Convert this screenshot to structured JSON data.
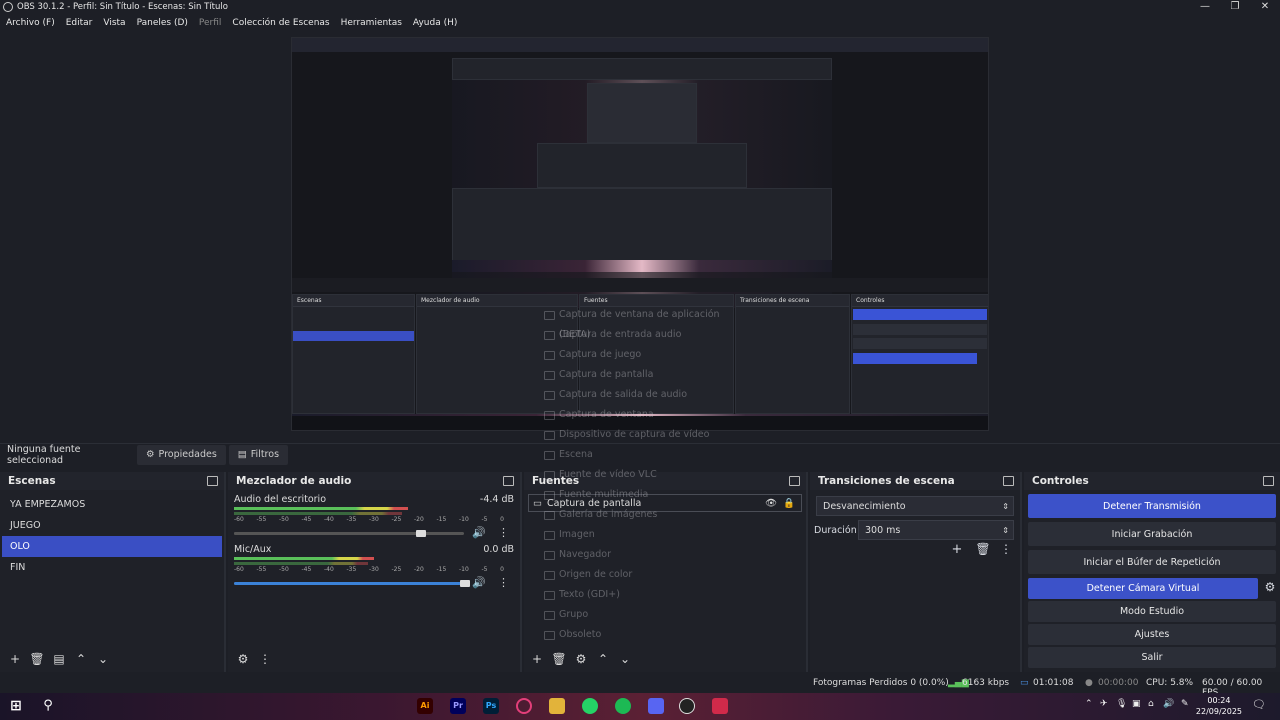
{
  "window": {
    "title": "OBS 30.1.2 - Perfil: Sin Título - Escenas: Sin Título"
  },
  "menu": [
    "Archivo (F)",
    "Editar",
    "Vista",
    "Paneles (D)",
    "Perfil",
    "Colección de Escenas",
    "Herramientas",
    "Ayuda (H)"
  ],
  "sourcebar": {
    "label": "Ninguna fuente seleccionad",
    "properties": "Propiedades",
    "filters": "Filtros"
  },
  "scenes": {
    "title": "Escenas",
    "items": [
      "YA EMPEZAMOS",
      "JUEGO",
      "OLO",
      "FIN"
    ],
    "selected": "OLO"
  },
  "mixer": {
    "title": "Mezclador de audio",
    "scale": [
      "-60",
      "-55",
      "-50",
      "-45",
      "-40",
      "-35",
      "-30",
      "-25",
      "-20",
      "-15",
      "-10",
      "-5",
      "0"
    ],
    "channels": [
      {
        "name": "Audio del escritorio",
        "db": "-4.4 dB",
        "level": 0.62,
        "volume": 0.85
      },
      {
        "name": "Mic/Aux",
        "db": "0.0 dB",
        "level": 0.55,
        "volume": 1.0
      }
    ]
  },
  "sources": {
    "title": "Fuentes",
    "items": [
      "Captura de pantalla"
    ]
  },
  "context_menu": [
    "Captura de ventana de aplicación (BETA)",
    "Captura de entrada audio",
    "Captura de juego",
    "Captura de pantalla",
    "Captura de salida de audio",
    "Captura de ventana",
    "Dispositivo de captura de vídeo",
    "Escena",
    "Fuente de vídeo VLC",
    "Fuente multimedia",
    "Galería de imágenes",
    "Imagen",
    "Navegador",
    "Origen de color",
    "Texto (GDI+)",
    "Grupo",
    "Obsoleto"
  ],
  "transitions": {
    "title": "Transiciones de escena",
    "type": "Desvanecimiento",
    "duration_label": "Duración",
    "duration": "300 ms"
  },
  "controls": {
    "title": "Controles",
    "buttons": [
      "Detener Transmisión",
      "Iniciar Grabación",
      "Iniciar el Búfer de Repetición",
      "Detener Cámara Virtual",
      "Modo Estudio",
      "Ajustes",
      "Salir"
    ]
  },
  "status": {
    "dropped": "Fotogramas Perdidos 0 (0.0%)",
    "bitrate": "6163 kbps",
    "live": "01:01:08",
    "rec": "00:00:00",
    "cpu": "CPU: 5.8%",
    "fps": "60.00 / 60.00 FPS"
  },
  "taskbar": {
    "time": "00:24",
    "date": "22/09/2025"
  },
  "colors": {
    "accent": "#3c52c9",
    "background": "#1d1f26",
    "panel": "#1f2128"
  }
}
